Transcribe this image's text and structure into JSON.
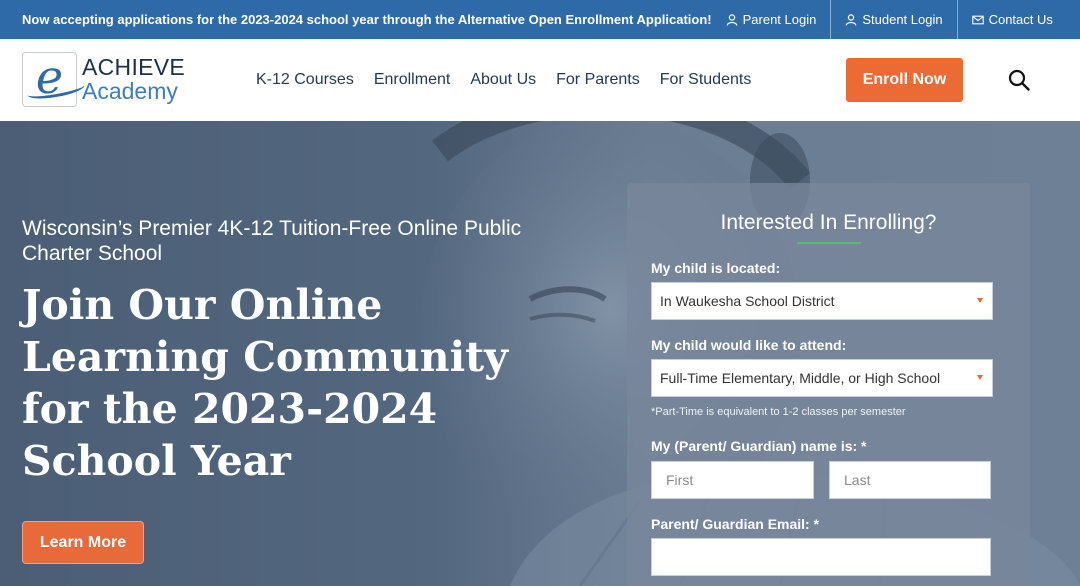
{
  "topbar": {
    "announcement": "Now accepting applications for the 2023-2024 school year through the Alternative Open Enrollment Application!",
    "links": [
      {
        "label": "Parent Login",
        "icon": "user-icon"
      },
      {
        "label": "Student Login",
        "icon": "user-icon"
      },
      {
        "label": "Contact Us",
        "icon": "envelope-icon"
      }
    ]
  },
  "header": {
    "logo": {
      "mark": "e",
      "line1": "ACHIEVE",
      "line2": "Academy"
    },
    "nav": [
      "K-12 Courses",
      "Enrollment",
      "About Us",
      "For Parents",
      "For Students"
    ],
    "cta": "Enroll Now",
    "search_icon": "search-icon"
  },
  "hero": {
    "subtitle": "Wisconsin’s Premier 4K-12 Tuition-Free Online Public Charter School",
    "title": "Join Our Online Learning Community for the 2023-2024 School Year",
    "button": "Learn More"
  },
  "form": {
    "title": "Interested In Enrolling?",
    "location_label": "My child is located:",
    "location_value": "In Waukesha School District",
    "attend_label": "My child would like to attend:",
    "attend_value": "Full-Time Elementary, Middle, or High School",
    "attend_note": "*Part-Time is equivalent to 1-2 classes per semester",
    "name_label": "My (Parent/ Guardian) name is:  *",
    "first_placeholder": "First",
    "last_placeholder": "Last",
    "email_label": "Parent/ Guardian Email:  *",
    "email_placeholder": ""
  },
  "colors": {
    "topbar": "#2f6aa8",
    "accent": "#ec6b35",
    "nav_text": "#263a52",
    "form_divider": "#5fb87a"
  }
}
